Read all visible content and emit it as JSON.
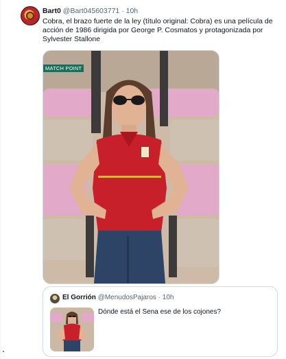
{
  "tweet": {
    "author_name": "Bart0",
    "author_handle": "@Bart045603771",
    "separator": "·",
    "time": "10h",
    "text": "Cobra, el brazo fuerte de la ley (título original: Cobra) es una película de acción de 1986 dirigida por George P. Cosmatos y protagonizada por Sylvester Stallone",
    "media_overlay_label": "MATCH POINT"
  },
  "quote": {
    "author_name": "El Gorrión",
    "author_handle": "@MenudosPajaros",
    "separator": "·",
    "time": "10h",
    "text": "Dónde está el Sena ese de los cojones?"
  },
  "colors": {
    "shirt_red": "#c8202a",
    "seat_pink": "#e3a9c8",
    "overlay_green": "#1f6b5a",
    "jeans_blue": "#2d4466"
  }
}
